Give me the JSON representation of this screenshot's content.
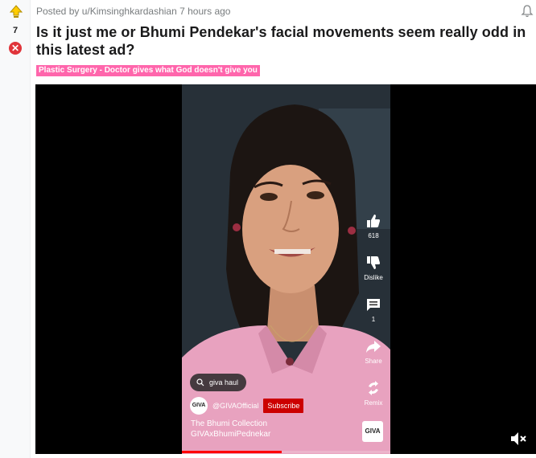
{
  "post": {
    "vote_count": "7",
    "meta": "Posted by u/Kimsinghkardashian 7 hours ago",
    "title": "Is it just me or Bhumi Pendekar's facial movements seem really odd in this latest ad?",
    "flair": "Plastic Surgery - Doctor gives what God doesn't give you"
  },
  "video": {
    "rail": {
      "like_count": "618",
      "dislike_label": "Dislike",
      "comment_count": "1",
      "share_label": "Share",
      "remix_label": "Remix"
    },
    "search_chip": "giva haul",
    "channel_avatar_text": "GIVA",
    "channel_name": "@GIVAOfficial",
    "subscribe_label": "Subscribe",
    "caption_line1": "The Bhumi Collection",
    "caption_line2": "GIVAxBhumiPednekar",
    "sound_thumb_text": "GIVA",
    "progress_fraction": 0.48
  },
  "colors": {
    "flair_bg": "#ff66ac",
    "subscribe_bg": "#cc0000",
    "downvote": "#e0343a",
    "progress": "#ff0000"
  },
  "icons": [
    "upvote-icon",
    "downvote-icon",
    "bell-icon",
    "like-icon",
    "dislike-icon",
    "comment-icon",
    "share-icon",
    "remix-icon",
    "search-icon",
    "mute-icon"
  ]
}
